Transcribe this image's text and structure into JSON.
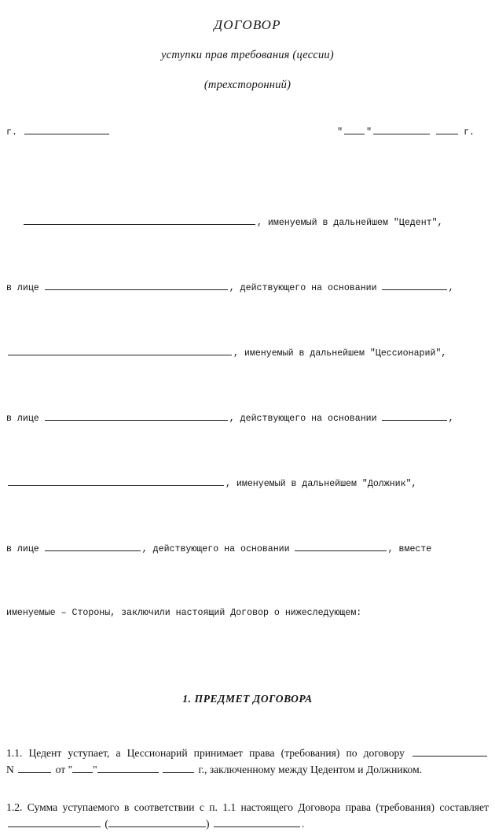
{
  "document": {
    "title": "ДОГОВОР",
    "subtitle": "уступки прав требования (цессии)",
    "subtitle2": "(трехсторонний)"
  },
  "place_date": {
    "city_prefix": "г.",
    "city_value": "",
    "quote_open": "\"",
    "quote_close": "\"",
    "day_value": "",
    "month_value": "",
    "year_value": "",
    "year_suffix": "г."
  },
  "parties": {
    "line1_tail": ", именуемый в дальнейшем \"Цедент\",",
    "line2_prefix": "в лице",
    "line2_mid": ", действующего на основании",
    "line2_tail": ",",
    "line3_tail": ", именуемый в дальнейшем \"Цессионарий\",",
    "line4_prefix": "в лице",
    "line4_mid": ", действующего на основании",
    "line4_tail": ",",
    "line5_tail": ", именуемый в дальнейшем \"Должник\",",
    "line6_prefix": "в лице",
    "line6_mid": ", действующего на основании",
    "line6_tail": ", вместе",
    "line7": "именуемые – Стороны, заключили настоящий Договор о нижеследующем:"
  },
  "section1": {
    "heading": "1. ПРЕДМЕТ ДОГОВОРА",
    "clause_1_1": {
      "number": "1.1.",
      "text_a": "Цедент уступает, а Цессионарий принимает права (требования) по договору",
      "text_n": "N",
      "text_ot": "от",
      "quote_open": "\"",
      "quote_close": "\"",
      "text_god": "г., заключенному между Цедентом и",
      "text_end": "Должником."
    },
    "clause_1_2": {
      "number": "1.2.",
      "text_a": "Сумма уступаемого в соответствии с п. 1.1 настоящего Договора права (требования)",
      "text_b": "составляет",
      "paren_open": "(",
      "paren_close": ")",
      "period": "."
    }
  }
}
